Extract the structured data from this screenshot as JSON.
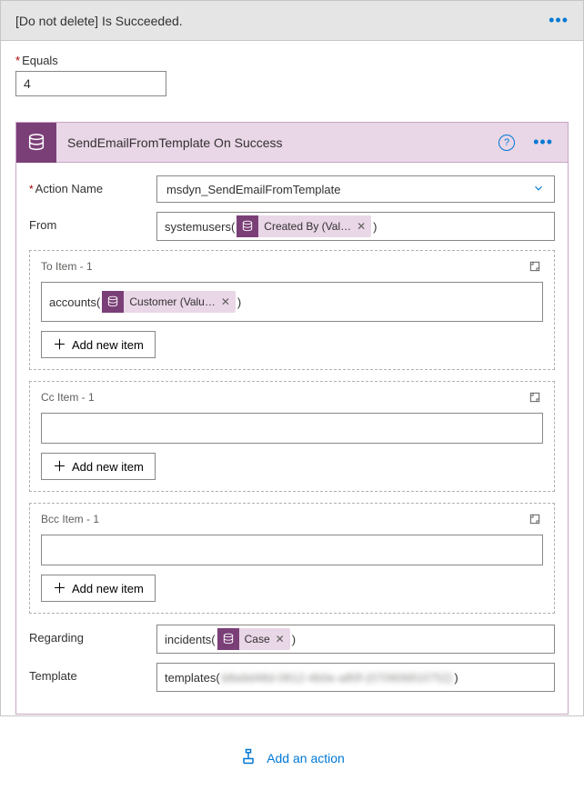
{
  "topbar": {
    "title": "[Do not delete] Is Succeeded."
  },
  "equals": {
    "label": "Equals",
    "value": "4"
  },
  "action": {
    "title": "SendEmailFromTemplate On Success",
    "fields": {
      "action_name": {
        "label": "Action Name",
        "value": "msdyn_SendEmailFromTemplate"
      },
      "from": {
        "label": "From",
        "prefix": "systemusers(",
        "suffix": ")",
        "token": "Created By (Val…"
      },
      "to": {
        "label": "To Item - 1",
        "prefix": "accounts(",
        "suffix": ")",
        "token": "Customer (Valu…",
        "add": "Add new item"
      },
      "cc": {
        "label": "Cc Item - 1",
        "add": "Add new item"
      },
      "bcc": {
        "label": "Bcc Item - 1",
        "add": "Add new item"
      },
      "regarding": {
        "label": "Regarding",
        "prefix": "incidents(",
        "suffix": ")",
        "token": "Case"
      },
      "template": {
        "label": "Template",
        "prefix": "templates(",
        "obscured": "b8a9d48d-0812-4b0e-a80f-(070906810752)",
        "suffix": ")"
      }
    }
  },
  "add_action": "Add an action",
  "icons": {
    "database": "database-icon",
    "help": "help-icon",
    "overflow": "overflow-icon",
    "collapse": "collapse-icon",
    "chevron_down": "chevron-down-icon",
    "plus": "plus-icon",
    "remove": "close-icon"
  }
}
